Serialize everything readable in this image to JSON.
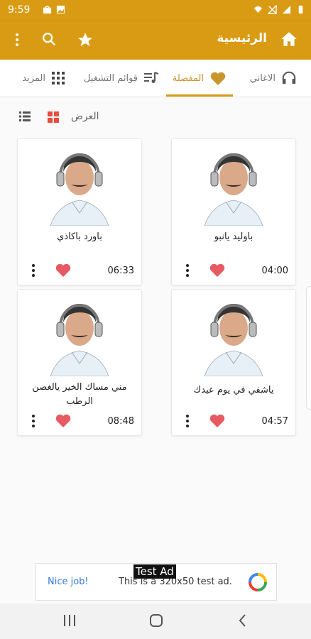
{
  "status": {
    "time": "9:59"
  },
  "appbar": {
    "title": "الرئيسية"
  },
  "tabs": [
    {
      "label": "الاغاني",
      "active": false
    },
    {
      "label": "المفضلة",
      "active": true
    },
    {
      "label": "قوائم التشغيل",
      "active": false
    },
    {
      "label": "المزيد",
      "active": false
    }
  ],
  "view": {
    "label": "العرض"
  },
  "songs": [
    {
      "title": "باوليد يانبو",
      "duration": "04:00"
    },
    {
      "title": "باورد باكاذي",
      "duration": "06:33"
    },
    {
      "title": "ياشفي في يوم عيدك",
      "duration": "04:57"
    },
    {
      "title": "مني مساك الخير يالغصن الرطب",
      "duration": "08:48"
    }
  ],
  "ad": {
    "tag": "Test Ad",
    "nice": "Nice job!",
    "desc": "This is a 320x50 test ad."
  },
  "colors": {
    "primary": "#d89b13",
    "accent": "#c8962a",
    "heart": "#e85a63",
    "grid_icon": "#e84c3d"
  }
}
